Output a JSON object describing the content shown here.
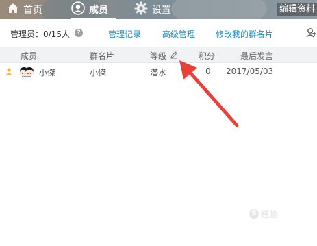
{
  "tabs": {
    "home": "首页",
    "members": "成员",
    "settings": "设置"
  },
  "edit_profile_label": "编辑资料",
  "toolbar": {
    "admin_count": "管理员：0/15人",
    "help_icon_glyph": "?",
    "manage_log": "管理记录",
    "advanced_manage": "高级管理",
    "edit_my_card": "修改我的群名片"
  },
  "table": {
    "columns": {
      "member": "成员",
      "card": "群名片",
      "level": "等级",
      "points": "积分",
      "last_speak": "最后发言"
    },
    "rows": [
      {
        "name": "小傑",
        "card": "小傑",
        "level": "潜水",
        "points": "0",
        "last_speak": "2017/05/03"
      }
    ]
  },
  "watermark": {
    "logo": "S",
    "text": "经验"
  },
  "colors": {
    "link": "#1a8fbf",
    "arrow": "#e8413a",
    "header_bg": "#f1f2f4"
  }
}
